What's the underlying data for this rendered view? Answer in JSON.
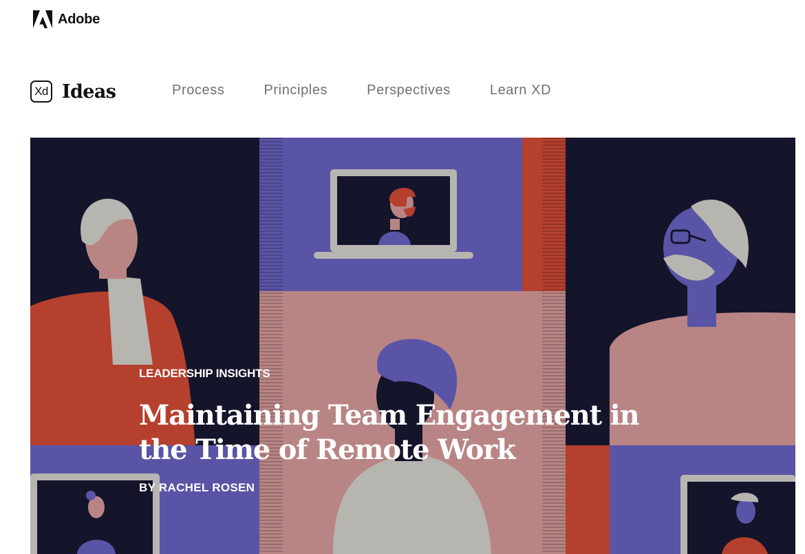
{
  "adobe": {
    "brand": "Adobe"
  },
  "header": {
    "badge": "Xd",
    "title": "Ideas",
    "nav": [
      {
        "label": "Process"
      },
      {
        "label": "Principles"
      },
      {
        "label": "Perspectives"
      },
      {
        "label": "Learn XD"
      }
    ]
  },
  "hero": {
    "category": "LEADERSHIP INSIGHTS",
    "headline": "Maintaining Team Engagement in the Time of Remote Work",
    "byline": "BY RACHEL ROSEN"
  },
  "colors": {
    "navy": "#14142b",
    "purple": "#5a54a6",
    "rust": "#b5402e",
    "pink": "#b88584",
    "gray": "#b7b5b0"
  },
  "icons": [
    "adobe-logo-icon",
    "xd-logo-icon"
  ]
}
